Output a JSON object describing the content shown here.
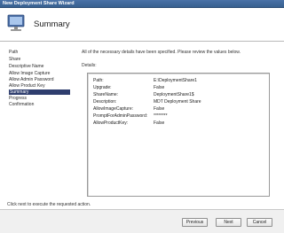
{
  "window": {
    "title": "New Deployment Share Wizard"
  },
  "header": {
    "title": "Summary",
    "icon": "monitor-icon"
  },
  "nav": {
    "items": [
      {
        "label": "Path",
        "active": false
      },
      {
        "label": "Share",
        "active": false
      },
      {
        "label": "Descriptive Name",
        "active": false
      },
      {
        "label": "Allow Image Capture",
        "active": false
      },
      {
        "label": "Allow Admin Password",
        "active": false
      },
      {
        "label": "Allow Product Key",
        "active": false
      },
      {
        "label": "Summary",
        "active": true
      },
      {
        "label": "Progress",
        "active": false
      },
      {
        "label": "Confirmation",
        "active": false
      }
    ],
    "active_color": "#2f3e6e"
  },
  "main": {
    "intro": "All of the necessary details have been specified.  Please review the values below.",
    "details_label": "Details:",
    "details": [
      {
        "key": "Path:",
        "value": "E:\\DeploymentShare1"
      },
      {
        "key": "Upgrade:",
        "value": "False"
      },
      {
        "key": "ShareName:",
        "value": "DeploymentShare1$"
      },
      {
        "key": "Description:",
        "value": "MDT Deployment Share"
      },
      {
        "key": "AllowImageCapture:",
        "value": "False"
      },
      {
        "key": "PromptForAdminPassword:",
        "value": "********"
      },
      {
        "key": "AllowProductKey:",
        "value": "False"
      }
    ],
    "footer_note": "Click next to execute the requested action."
  },
  "buttons": {
    "previous": "Previous",
    "next": "Next",
    "cancel": "Cancel"
  }
}
